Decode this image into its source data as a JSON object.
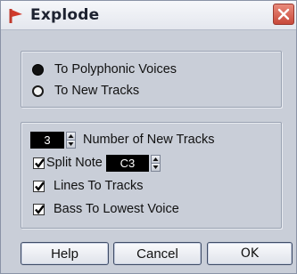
{
  "window": {
    "title": "Explode",
    "logo_icon": "cubase-logo-icon",
    "close_icon": "close-icon",
    "accent_color": "#c0392b"
  },
  "mode_options": {
    "selected": "To Polyphonic Voices",
    "items": [
      {
        "label": "To Polyphonic Voices",
        "selected": true
      },
      {
        "label": "To New Tracks",
        "selected": false
      }
    ]
  },
  "settings": {
    "number_of_new_tracks": {
      "value": "3",
      "label": "Number of New Tracks"
    },
    "split_note": {
      "checked": true,
      "label": "Split Note",
      "value": "C3"
    },
    "lines_to_tracks": {
      "checked": true,
      "label": "Lines To Tracks"
    },
    "bass_to_lowest_voice": {
      "checked": true,
      "label": "Bass To Lowest Voice"
    }
  },
  "buttons": {
    "help": "Help",
    "cancel": "Cancel",
    "ok": "OK"
  }
}
